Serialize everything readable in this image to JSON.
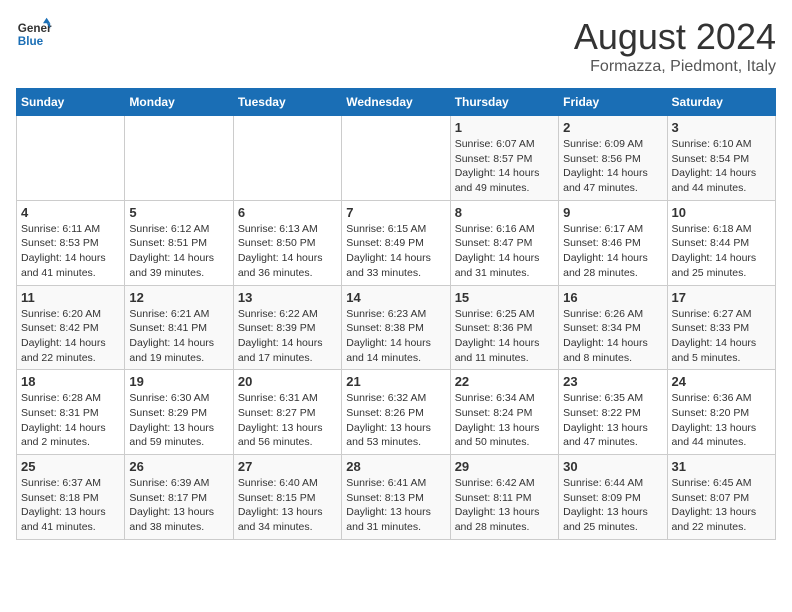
{
  "header": {
    "logo_line1": "General",
    "logo_line2": "Blue",
    "month_title": "August 2024",
    "location": "Formazza, Piedmont, Italy"
  },
  "weekdays": [
    "Sunday",
    "Monday",
    "Tuesday",
    "Wednesday",
    "Thursday",
    "Friday",
    "Saturday"
  ],
  "weeks": [
    [
      {
        "day": "",
        "info": ""
      },
      {
        "day": "",
        "info": ""
      },
      {
        "day": "",
        "info": ""
      },
      {
        "day": "",
        "info": ""
      },
      {
        "day": "1",
        "info": "Sunrise: 6:07 AM\nSunset: 8:57 PM\nDaylight: 14 hours and 49 minutes."
      },
      {
        "day": "2",
        "info": "Sunrise: 6:09 AM\nSunset: 8:56 PM\nDaylight: 14 hours and 47 minutes."
      },
      {
        "day": "3",
        "info": "Sunrise: 6:10 AM\nSunset: 8:54 PM\nDaylight: 14 hours and 44 minutes."
      }
    ],
    [
      {
        "day": "4",
        "info": "Sunrise: 6:11 AM\nSunset: 8:53 PM\nDaylight: 14 hours and 41 minutes."
      },
      {
        "day": "5",
        "info": "Sunrise: 6:12 AM\nSunset: 8:51 PM\nDaylight: 14 hours and 39 minutes."
      },
      {
        "day": "6",
        "info": "Sunrise: 6:13 AM\nSunset: 8:50 PM\nDaylight: 14 hours and 36 minutes."
      },
      {
        "day": "7",
        "info": "Sunrise: 6:15 AM\nSunset: 8:49 PM\nDaylight: 14 hours and 33 minutes."
      },
      {
        "day": "8",
        "info": "Sunrise: 6:16 AM\nSunset: 8:47 PM\nDaylight: 14 hours and 31 minutes."
      },
      {
        "day": "9",
        "info": "Sunrise: 6:17 AM\nSunset: 8:46 PM\nDaylight: 14 hours and 28 minutes."
      },
      {
        "day": "10",
        "info": "Sunrise: 6:18 AM\nSunset: 8:44 PM\nDaylight: 14 hours and 25 minutes."
      }
    ],
    [
      {
        "day": "11",
        "info": "Sunrise: 6:20 AM\nSunset: 8:42 PM\nDaylight: 14 hours and 22 minutes."
      },
      {
        "day": "12",
        "info": "Sunrise: 6:21 AM\nSunset: 8:41 PM\nDaylight: 14 hours and 19 minutes."
      },
      {
        "day": "13",
        "info": "Sunrise: 6:22 AM\nSunset: 8:39 PM\nDaylight: 14 hours and 17 minutes."
      },
      {
        "day": "14",
        "info": "Sunrise: 6:23 AM\nSunset: 8:38 PM\nDaylight: 14 hours and 14 minutes."
      },
      {
        "day": "15",
        "info": "Sunrise: 6:25 AM\nSunset: 8:36 PM\nDaylight: 14 hours and 11 minutes."
      },
      {
        "day": "16",
        "info": "Sunrise: 6:26 AM\nSunset: 8:34 PM\nDaylight: 14 hours and 8 minutes."
      },
      {
        "day": "17",
        "info": "Sunrise: 6:27 AM\nSunset: 8:33 PM\nDaylight: 14 hours and 5 minutes."
      }
    ],
    [
      {
        "day": "18",
        "info": "Sunrise: 6:28 AM\nSunset: 8:31 PM\nDaylight: 14 hours and 2 minutes."
      },
      {
        "day": "19",
        "info": "Sunrise: 6:30 AM\nSunset: 8:29 PM\nDaylight: 13 hours and 59 minutes."
      },
      {
        "day": "20",
        "info": "Sunrise: 6:31 AM\nSunset: 8:27 PM\nDaylight: 13 hours and 56 minutes."
      },
      {
        "day": "21",
        "info": "Sunrise: 6:32 AM\nSunset: 8:26 PM\nDaylight: 13 hours and 53 minutes."
      },
      {
        "day": "22",
        "info": "Sunrise: 6:34 AM\nSunset: 8:24 PM\nDaylight: 13 hours and 50 minutes."
      },
      {
        "day": "23",
        "info": "Sunrise: 6:35 AM\nSunset: 8:22 PM\nDaylight: 13 hours and 47 minutes."
      },
      {
        "day": "24",
        "info": "Sunrise: 6:36 AM\nSunset: 8:20 PM\nDaylight: 13 hours and 44 minutes."
      }
    ],
    [
      {
        "day": "25",
        "info": "Sunrise: 6:37 AM\nSunset: 8:18 PM\nDaylight: 13 hours and 41 minutes."
      },
      {
        "day": "26",
        "info": "Sunrise: 6:39 AM\nSunset: 8:17 PM\nDaylight: 13 hours and 38 minutes."
      },
      {
        "day": "27",
        "info": "Sunrise: 6:40 AM\nSunset: 8:15 PM\nDaylight: 13 hours and 34 minutes."
      },
      {
        "day": "28",
        "info": "Sunrise: 6:41 AM\nSunset: 8:13 PM\nDaylight: 13 hours and 31 minutes."
      },
      {
        "day": "29",
        "info": "Sunrise: 6:42 AM\nSunset: 8:11 PM\nDaylight: 13 hours and 28 minutes."
      },
      {
        "day": "30",
        "info": "Sunrise: 6:44 AM\nSunset: 8:09 PM\nDaylight: 13 hours and 25 minutes."
      },
      {
        "day": "31",
        "info": "Sunrise: 6:45 AM\nSunset: 8:07 PM\nDaylight: 13 hours and 22 minutes."
      }
    ]
  ]
}
